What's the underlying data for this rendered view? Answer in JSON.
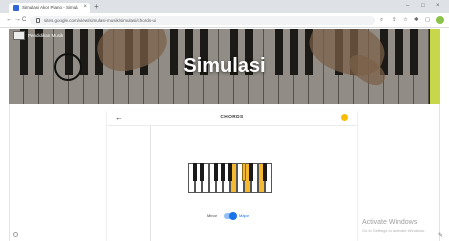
{
  "browser": {
    "tab_title": "Simulasi Akor Piano - Simulasi",
    "tab_close": "×",
    "new_tab": "+",
    "url": "sites.google.com/view/simulasi-musik/simulasi/chords-ui",
    "nav": {
      "back": "←",
      "forward": "→",
      "reload": "C"
    },
    "window_controls": {
      "minimize": "–",
      "maximize": "□",
      "close": "×"
    }
  },
  "hero": {
    "brand": "Pendidikan Musik",
    "title": "Simulasi"
  },
  "panel": {
    "back": "←",
    "title": "CHORDS"
  },
  "piano": {
    "white_keys_active": [
      false,
      false,
      false,
      false,
      false,
      false,
      true,
      false,
      true,
      false,
      true,
      false
    ],
    "black_keys_active": [
      false,
      false,
      false,
      false,
      false,
      true,
      false,
      false
    ]
  },
  "mode": {
    "minor_label": "Minor",
    "major_label": "Major",
    "major_selected": true
  },
  "watermark": {
    "title": "Activate Windows",
    "subtitle": "Go to Settings to activate Windows."
  },
  "colors": {
    "highlight": "#f5b82e",
    "accent": "#1a73e8"
  }
}
